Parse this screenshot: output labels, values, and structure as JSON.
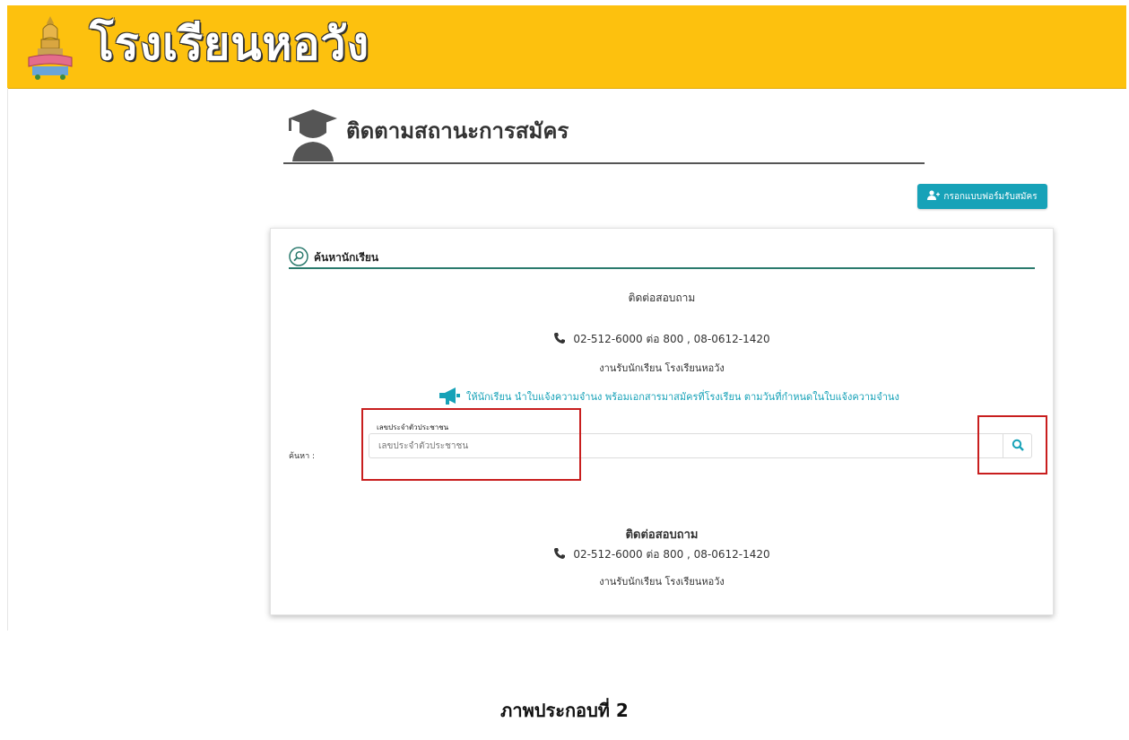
{
  "header": {
    "site_title": "โรงเรียนหอวัง",
    "logo_icon": "school-emblem-icon",
    "bg_color": "#fdc10e"
  },
  "page": {
    "heading": "ติดตามสถานะการสมัคร",
    "heading_icon": "graduate-icon",
    "apply_button_label": "กรอกแบบฟอร์มรับสมัคร",
    "apply_button_icon": "add-user-icon",
    "accent_color": "#17a2b8"
  },
  "panel": {
    "title": "ค้นหานักเรียน",
    "title_icon": "search-circle-icon",
    "contact_top": {
      "title": "ติดต่อสอบถาม",
      "phone": "02-512-6000 ต่อ 800 , 08-0612-1420",
      "office": "งานรับนักเรียน โรงเรียนหอวัง"
    },
    "announcement": "ให้นักเรียน นำใบแจ้งความจำนง พร้อมเอกสารมาสมัครที่โรงเรียน ตามวันที่กำหนดในใบแจ้งความจำนง",
    "announcement_icon": "megaphone-icon",
    "search": {
      "label": "ค้นหา :",
      "field_label": "เลขประจำตัวประชาชน",
      "placeholder": "เลขประจำตัวประชาชน",
      "button_icon": "search-icon"
    },
    "contact_bottom": {
      "title": "ติดต่อสอบถาม",
      "phone": "02-512-6000 ต่อ 800 , 08-0612-1420",
      "office": "งานรับนักเรียน โรงเรียนหอวัง"
    }
  },
  "figure_caption": "ภาพประกอบที่ 2",
  "highlight_color": "#c81e1e"
}
